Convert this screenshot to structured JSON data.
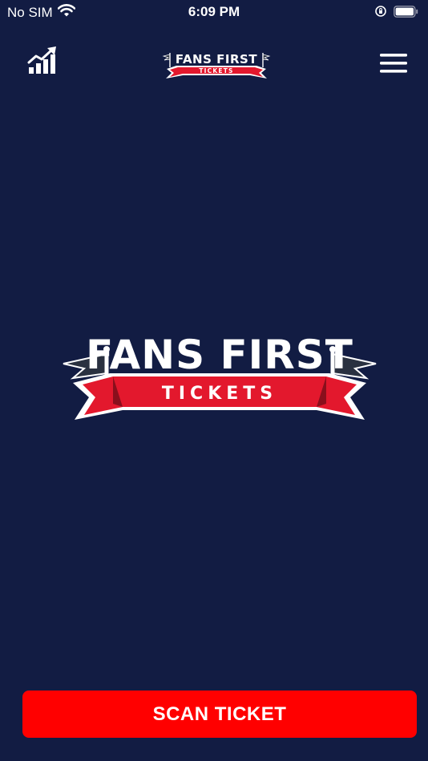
{
  "status_bar": {
    "carrier": "No SIM",
    "time": "6:09 PM"
  },
  "nav": {
    "logo": {
      "line1": "FANS FIRST",
      "line2": "TICKETS"
    }
  },
  "hero_logo": {
    "line1": "FANS FIRST",
    "line2": "TICKETS"
  },
  "actions": {
    "scan_label": "SCAN TICKET"
  },
  "colors": {
    "background": "#121c43",
    "brand_red": "#ff0000",
    "banner_red": "#e3182d",
    "flag_dark": "#2a3140",
    "text": "#ffffff"
  },
  "icons": {
    "wifi": "wifi-icon",
    "orientation_lock": "orientation-lock-icon",
    "battery": "battery-icon",
    "chart": "chart-growth-icon",
    "menu": "hamburger-menu-icon"
  }
}
